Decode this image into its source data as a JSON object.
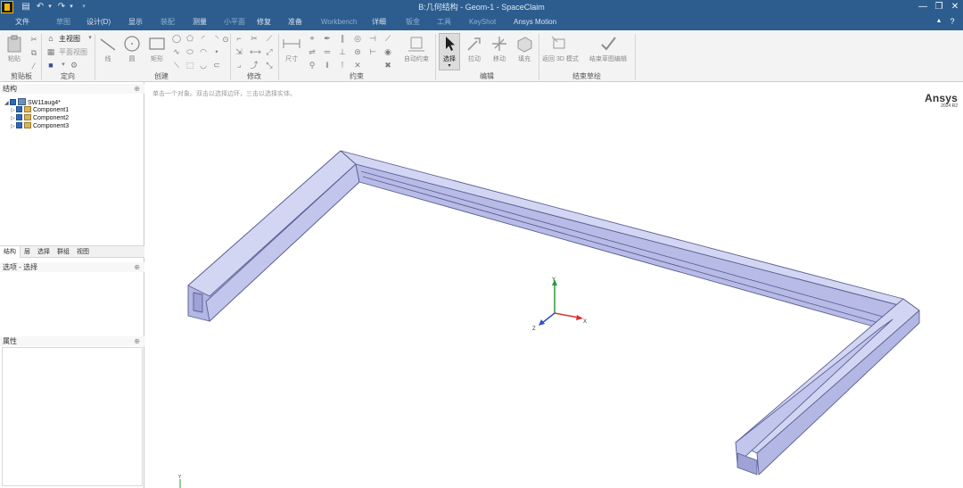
{
  "titlebar": {
    "title": "B:几何结构 - Geom-1 - SpaceClaim"
  },
  "menu": {
    "file": "文件",
    "items": [
      "草图",
      "设计(D)",
      "显示",
      "装配",
      "测量",
      "小平面",
      "修复",
      "准备",
      "Workbench",
      "详细",
      "钣金",
      "工具",
      "KeyShot",
      "Ansys Motion"
    ],
    "active": "Ansys Motion"
  },
  "ribbon": {
    "groups": {
      "clipboard": "剪贴板",
      "orient": "定向",
      "create": "创建",
      "modify": "修改",
      "constraint": "约束",
      "edit": "编辑",
      "exit_sketch": "结束草绘"
    },
    "orient_home": "主视图",
    "orient_plane": "平面视图",
    "buttons": {
      "paste": "粘贴",
      "line": "线",
      "circle": "圆",
      "rect": "矩形",
      "dimension": "尺寸",
      "auto_constrain": "自动约束",
      "select": "选择",
      "pull": "拉动",
      "move": "移动",
      "fill": "填充",
      "return_3d": "返回 3D 模式",
      "finish_sketch": "结束草图编辑"
    }
  },
  "structure": {
    "header": "结构",
    "root": "SW11aug4*",
    "components": [
      "Component1",
      "Component2",
      "Component3"
    ]
  },
  "tabs": [
    "结构",
    "层",
    "选择",
    "群组",
    "视图"
  ],
  "options_panel": {
    "header": "选项 - 选择"
  },
  "properties_panel": {
    "header": "属性"
  },
  "viewport": {
    "hint": "单击一个对象。双击以选择边环，三击以选择实体。",
    "brand": "Ansys",
    "version": "2024 R2",
    "axis_labels": {
      "x": "X",
      "y": "Y",
      "z": "Z"
    }
  },
  "colors": {
    "title_bg": "#2d5d8f",
    "part_face_top": "#d3d6f2",
    "part_face_side": "#b3b7e3",
    "part_edge": "#5a5f93",
    "axis_x": "#d93030",
    "axis_y": "#2a9a3a",
    "axis_z": "#2d4fd0"
  }
}
